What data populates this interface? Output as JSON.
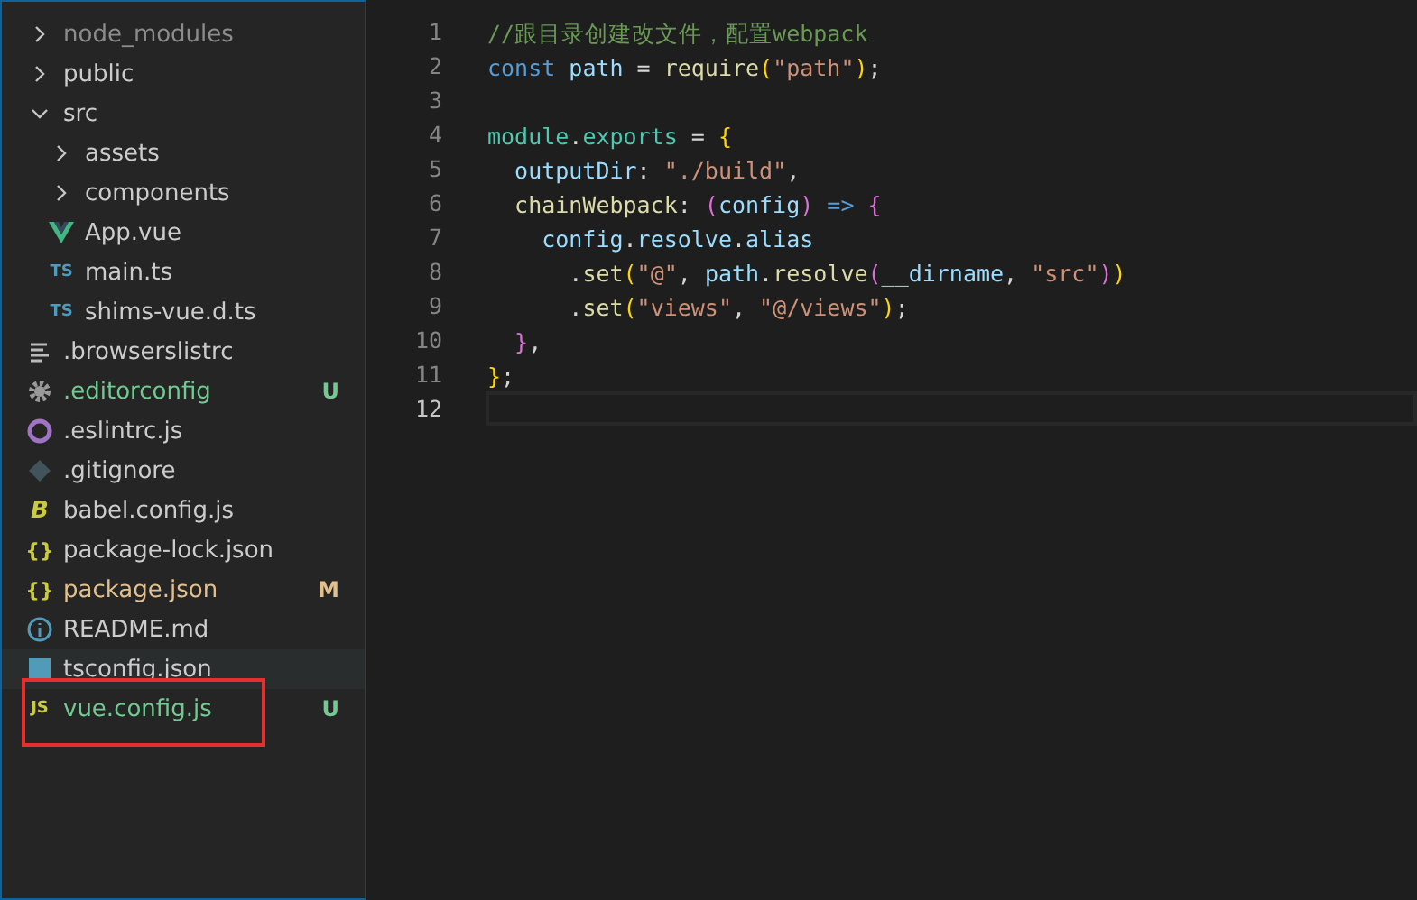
{
  "explorer": {
    "items": [
      {
        "name": "node_modules",
        "kind": "folder",
        "expanded": false,
        "color": "#8c8c8c"
      },
      {
        "name": "public",
        "kind": "folder",
        "expanded": false,
        "color": "#cccccc"
      },
      {
        "name": "src",
        "kind": "folder",
        "expanded": true,
        "color": "#cccccc",
        "children": [
          {
            "name": "assets",
            "kind": "folder",
            "expanded": false,
            "color": "#cccccc"
          },
          {
            "name": "components",
            "kind": "folder",
            "expanded": false,
            "color": "#cccccc"
          },
          {
            "name": "App.vue",
            "kind": "vue",
            "color": "#cccccc"
          },
          {
            "name": "main.ts",
            "kind": "blueletters",
            "icon_text": "TS",
            "color": "#cccccc"
          },
          {
            "name": "shims-vue.d.ts",
            "kind": "blueletters",
            "icon_text": "TS",
            "color": "#cccccc"
          }
        ]
      },
      {
        "name": ".browserslistrc",
        "kind": "lines",
        "color": "#cccccc"
      },
      {
        "name": ".editorconfig",
        "kind": "gear",
        "color": "#73c991",
        "status": "U"
      },
      {
        "name": ".eslintrc.js",
        "kind": "ring",
        "color": "#cccccc"
      },
      {
        "name": ".gitignore",
        "kind": "diamond",
        "color": "#cccccc"
      },
      {
        "name": "babel.config.js",
        "kind": "italicletter",
        "icon_text": "B",
        "color": "#cccccc"
      },
      {
        "name": "package-lock.json",
        "kind": "braces",
        "icon_text": "{}",
        "color": "#cccccc"
      },
      {
        "name": "package.json",
        "kind": "braces",
        "icon_text": "{}",
        "color": "#e2c08d",
        "status": "M"
      },
      {
        "name": "README.md",
        "kind": "info",
        "color": "#cccccc"
      },
      {
        "name": "tsconfig.json",
        "kind": "square",
        "color": "#cccccc",
        "hovered": true
      },
      {
        "name": "vue.config.js",
        "kind": "yellowletters",
        "icon_text": "JS",
        "color": "#73c991",
        "status": "U",
        "annotated": true
      }
    ]
  },
  "editor": {
    "lines": [
      {
        "number": "1",
        "current": false,
        "tokens": [
          {
            "t": "//跟目录创建改文件，配置webpack",
            "color": "#6a9955"
          }
        ]
      },
      {
        "number": "2",
        "current": false,
        "tokens": [
          {
            "t": "const",
            "color": "#569cd6"
          },
          {
            "t": " path",
            "color": "#9cdcfe"
          },
          {
            "t": " = ",
            "color": "#d4d4d4"
          },
          {
            "t": "require",
            "color": "#dcdcaa"
          },
          {
            "t": "(",
            "color": "#ffd700"
          },
          {
            "t": "\"path\"",
            "color": "#ce9178"
          },
          {
            "t": ")",
            "color": "#ffd700"
          },
          {
            "t": ";",
            "color": "#d4d4d4"
          }
        ]
      },
      {
        "number": "3",
        "current": false
      },
      {
        "number": "4",
        "current": false,
        "tokens": [
          {
            "t": "module",
            "color": "#4ec9b0"
          },
          {
            "t": ".",
            "color": "#d4d4d4"
          },
          {
            "t": "exports",
            "color": "#4ec9b0"
          },
          {
            "t": " = ",
            "color": "#d4d4d4"
          },
          {
            "t": "{",
            "color": "#ffd700"
          }
        ]
      },
      {
        "number": "5",
        "current": false,
        "tokens": [
          {
            "t": "  outputDir",
            "color": "#9cdcfe"
          },
          {
            "t": ": ",
            "color": "#d4d4d4"
          },
          {
            "t": "\"./build\"",
            "color": "#ce9178"
          },
          {
            "t": ",",
            "color": "#d4d4d4"
          }
        ]
      },
      {
        "number": "6",
        "current": false,
        "tokens": [
          {
            "t": "  chainWebpack",
            "color": "#dcdcaa"
          },
          {
            "t": ": ",
            "color": "#d4d4d4"
          },
          {
            "t": "(",
            "color": "#da70d6"
          },
          {
            "t": "config",
            "color": "#9cdcfe"
          },
          {
            "t": ")",
            "color": "#da70d6"
          },
          {
            "t": " => ",
            "color": "#569cd6"
          },
          {
            "t": "{",
            "color": "#da70d6"
          }
        ]
      },
      {
        "number": "7",
        "current": false,
        "tokens": [
          {
            "t": "    config",
            "color": "#9cdcfe"
          },
          {
            "t": ".",
            "color": "#d4d4d4"
          },
          {
            "t": "resolve",
            "color": "#9cdcfe"
          },
          {
            "t": ".",
            "color": "#d4d4d4"
          },
          {
            "t": "alias",
            "color": "#9cdcfe"
          }
        ]
      },
      {
        "number": "8",
        "current": false,
        "tokens": [
          {
            "t": "      .",
            "color": "#d4d4d4"
          },
          {
            "t": "set",
            "color": "#dcdcaa"
          },
          {
            "t": "(",
            "color": "#ffd700"
          },
          {
            "t": "\"@\"",
            "color": "#ce9178"
          },
          {
            "t": ", ",
            "color": "#d4d4d4"
          },
          {
            "t": "path",
            "color": "#9cdcfe"
          },
          {
            "t": ".",
            "color": "#d4d4d4"
          },
          {
            "t": "resolve",
            "color": "#dcdcaa"
          },
          {
            "t": "(",
            "color": "#da70d6"
          },
          {
            "t": "__dirname",
            "color": "#9cdcfe"
          },
          {
            "t": ", ",
            "color": "#d4d4d4"
          },
          {
            "t": "\"src\"",
            "color": "#ce9178"
          },
          {
            "t": ")",
            "color": "#da70d6"
          },
          {
            "t": ")",
            "color": "#ffd700"
          }
        ]
      },
      {
        "number": "9",
        "current": false,
        "tokens": [
          {
            "t": "      .",
            "color": "#d4d4d4"
          },
          {
            "t": "set",
            "color": "#dcdcaa"
          },
          {
            "t": "(",
            "color": "#ffd700"
          },
          {
            "t": "\"views\"",
            "color": "#ce9178"
          },
          {
            "t": ", ",
            "color": "#d4d4d4"
          },
          {
            "t": "\"@/views\"",
            "color": "#ce9178"
          },
          {
            "t": ")",
            "color": "#ffd700"
          },
          {
            "t": ";",
            "color": "#d4d4d4"
          }
        ]
      },
      {
        "number": "10",
        "current": false,
        "tokens": [
          {
            "t": "  }",
            "color": "#da70d6"
          },
          {
            "t": ",",
            "color": "#d4d4d4"
          }
        ]
      },
      {
        "number": "11",
        "current": false,
        "tokens": [
          {
            "t": "}",
            "color": "#ffd700"
          },
          {
            "t": ";",
            "color": "#d4d4d4"
          }
        ]
      },
      {
        "number": "12",
        "current": true
      }
    ]
  }
}
